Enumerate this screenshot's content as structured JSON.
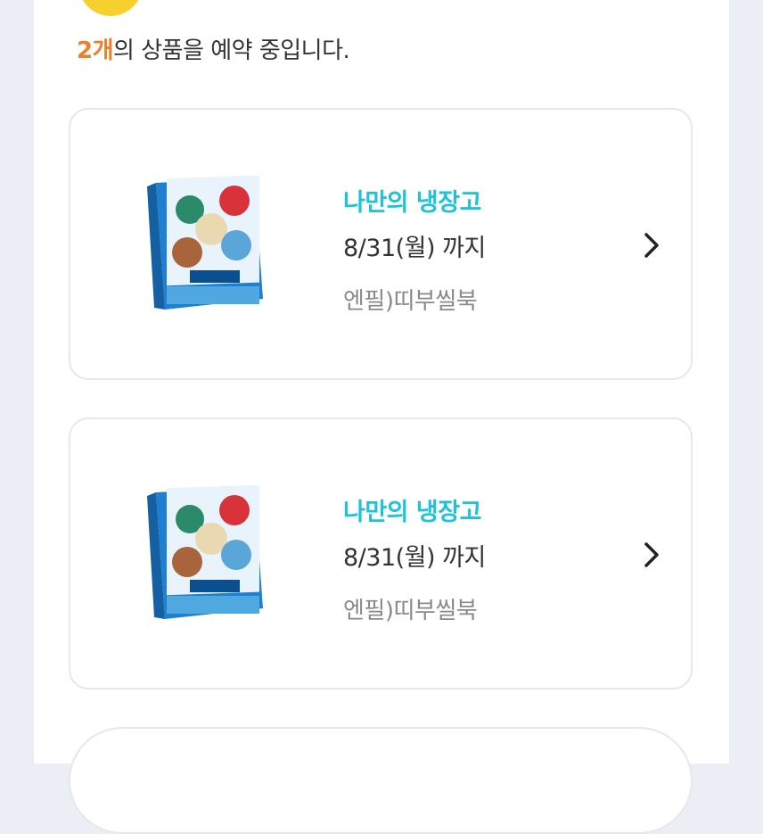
{
  "summary": {
    "count": "2개",
    "text": "의 상품을 예약 중입니다."
  },
  "reservations": [
    {
      "store": "나만의 냉장고",
      "deadline": "8/31(월) 까지",
      "product": "엔필)띠부씰북",
      "thumbnail": "sticker-book-box-image",
      "icon": "chevron-right-icon"
    },
    {
      "store": "나만의 냉장고",
      "deadline": "8/31(월) 까지",
      "product": "엔필)띠부씰북",
      "thumbnail": "sticker-book-box-image",
      "icon": "chevron-right-icon"
    }
  ],
  "bottom_button": {
    "label": ""
  },
  "colors": {
    "accent_count": "#f07d2a",
    "store_name": "#1ec3d8",
    "avatar": "#f7cf2e",
    "background": "#eceef5"
  }
}
